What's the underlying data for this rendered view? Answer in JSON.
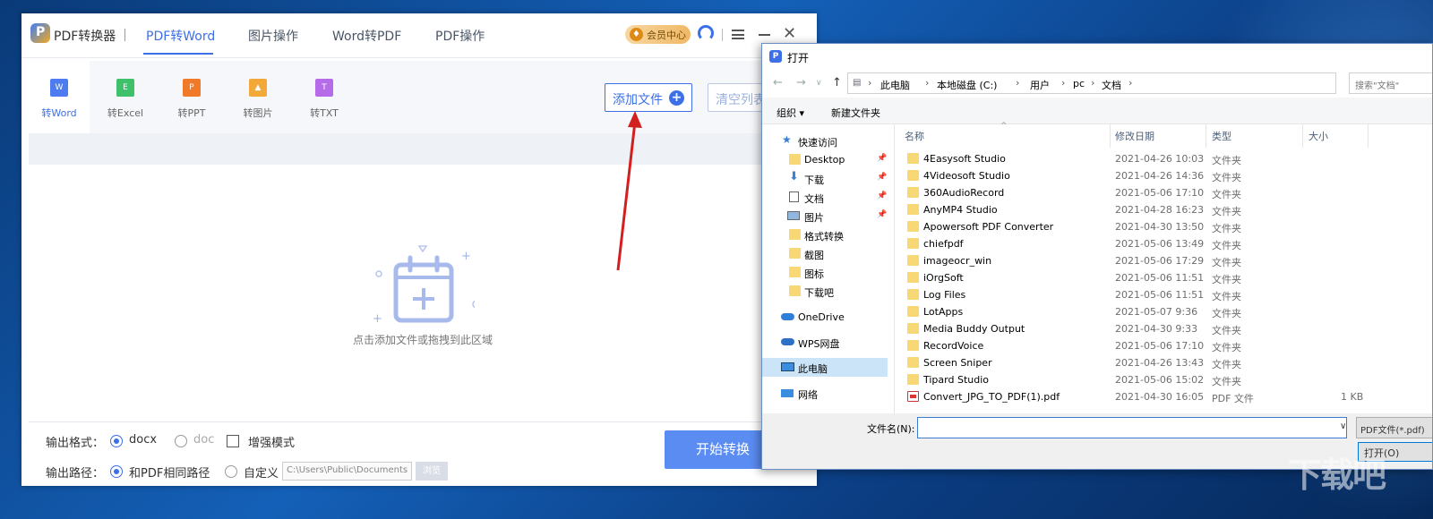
{
  "app": {
    "title": "PDF转换器",
    "nav": [
      "PDF转Word",
      "图片操作",
      "Word转PDF",
      "PDF操作"
    ],
    "vip_label": "会员中心",
    "tools": [
      {
        "label": "转Word",
        "icon_text": "W",
        "color": "#4d7cf0"
      },
      {
        "label": "转Excel",
        "icon_text": "E",
        "color": "#3fc06a"
      },
      {
        "label": "转PPT",
        "icon_text": "P",
        "color": "#f07a2a"
      },
      {
        "label": "转图片",
        "icon_text": "▲",
        "color": "#f3a83a"
      },
      {
        "label": "转TXT",
        "icon_text": "T",
        "color": "#b66ce8"
      }
    ],
    "add_file": "添加文件",
    "clear_list": "清空列表",
    "drop_hint": "点击添加文件或拖拽到此区域",
    "output_format_label": "输出格式：",
    "format_docx": "docx",
    "format_doc": "doc",
    "enhanced_mode": "增强模式",
    "output_path_label": "输出路径：",
    "path_same": "和PDF相同路径",
    "path_custom": "自定义",
    "path_value": "C:\\Users\\Public\\Documents",
    "browse": "浏览",
    "start": "开始转换"
  },
  "dialog": {
    "title": "打开",
    "breadcrumb": [
      "此电脑",
      "本地磁盘 (C:)",
      "用户",
      "pc",
      "文档"
    ],
    "search_placeholder": "搜索\"文档\"",
    "organize": "组织 ▾",
    "new_folder": "新建文件夹",
    "nav_items": [
      {
        "label": "快速访问",
        "icon": "star-icon"
      },
      {
        "label": "Desktop",
        "icon": "folder-icon",
        "pinned": true
      },
      {
        "label": "下载",
        "icon": "download-icon",
        "pinned": true
      },
      {
        "label": "文档",
        "icon": "document-icon",
        "pinned": true
      },
      {
        "label": "图片",
        "icon": "picture-icon",
        "pinned": true
      },
      {
        "label": "格式转换",
        "icon": "folder-icon"
      },
      {
        "label": "截图",
        "icon": "folder-icon"
      },
      {
        "label": "图标",
        "icon": "folder-icon"
      },
      {
        "label": "下载吧",
        "icon": "folder-icon"
      },
      {
        "label": "OneDrive",
        "icon": "cloud-icon"
      },
      {
        "label": "WPS网盘",
        "icon": "cloud-icon"
      },
      {
        "label": "此电脑",
        "icon": "computer-icon",
        "selected": true
      },
      {
        "label": "网络",
        "icon": "network-icon"
      }
    ],
    "columns": [
      "名称",
      "修改日期",
      "类型",
      "大小"
    ],
    "files": [
      {
        "name": "4Easysoft Studio",
        "date": "2021-04-26 10:03",
        "type": "文件夹",
        "size": ""
      },
      {
        "name": "4Videosoft Studio",
        "date": "2021-04-26 14:36",
        "type": "文件夹",
        "size": ""
      },
      {
        "name": "360AudioRecord",
        "date": "2021-05-06 17:10",
        "type": "文件夹",
        "size": ""
      },
      {
        "name": "AnyMP4 Studio",
        "date": "2021-04-28 16:23",
        "type": "文件夹",
        "size": ""
      },
      {
        "name": "Apowersoft PDF Converter",
        "date": "2021-04-30 13:50",
        "type": "文件夹",
        "size": ""
      },
      {
        "name": "chiefpdf",
        "date": "2021-05-06 13:49",
        "type": "文件夹",
        "size": ""
      },
      {
        "name": "imageocr_win",
        "date": "2021-05-06 17:29",
        "type": "文件夹",
        "size": ""
      },
      {
        "name": "iOrgSoft",
        "date": "2021-05-06 11:51",
        "type": "文件夹",
        "size": ""
      },
      {
        "name": "Log Files",
        "date": "2021-05-06 11:51",
        "type": "文件夹",
        "size": ""
      },
      {
        "name": "LotApps",
        "date": "2021-05-07 9:36",
        "type": "文件夹",
        "size": ""
      },
      {
        "name": "Media Buddy Output",
        "date": "2021-04-30 9:33",
        "type": "文件夹",
        "size": ""
      },
      {
        "name": "RecordVoice",
        "date": "2021-05-06 17:10",
        "type": "文件夹",
        "size": ""
      },
      {
        "name": "Screen Sniper",
        "date": "2021-04-26 13:43",
        "type": "文件夹",
        "size": ""
      },
      {
        "name": "Tipard Studio",
        "date": "2021-05-06 15:02",
        "type": "文件夹",
        "size": ""
      },
      {
        "name": "Convert_JPG_TO_PDF(1).pdf",
        "date": "2021-04-30 16:05",
        "type": "PDF 文件",
        "size": "1 KB",
        "pdf": true
      }
    ],
    "filename_label": "文件名(N):",
    "filename_value": "",
    "filetype": "PDF文件(*.pdf)",
    "open": "打开(O)"
  },
  "watermark": "下载吧"
}
